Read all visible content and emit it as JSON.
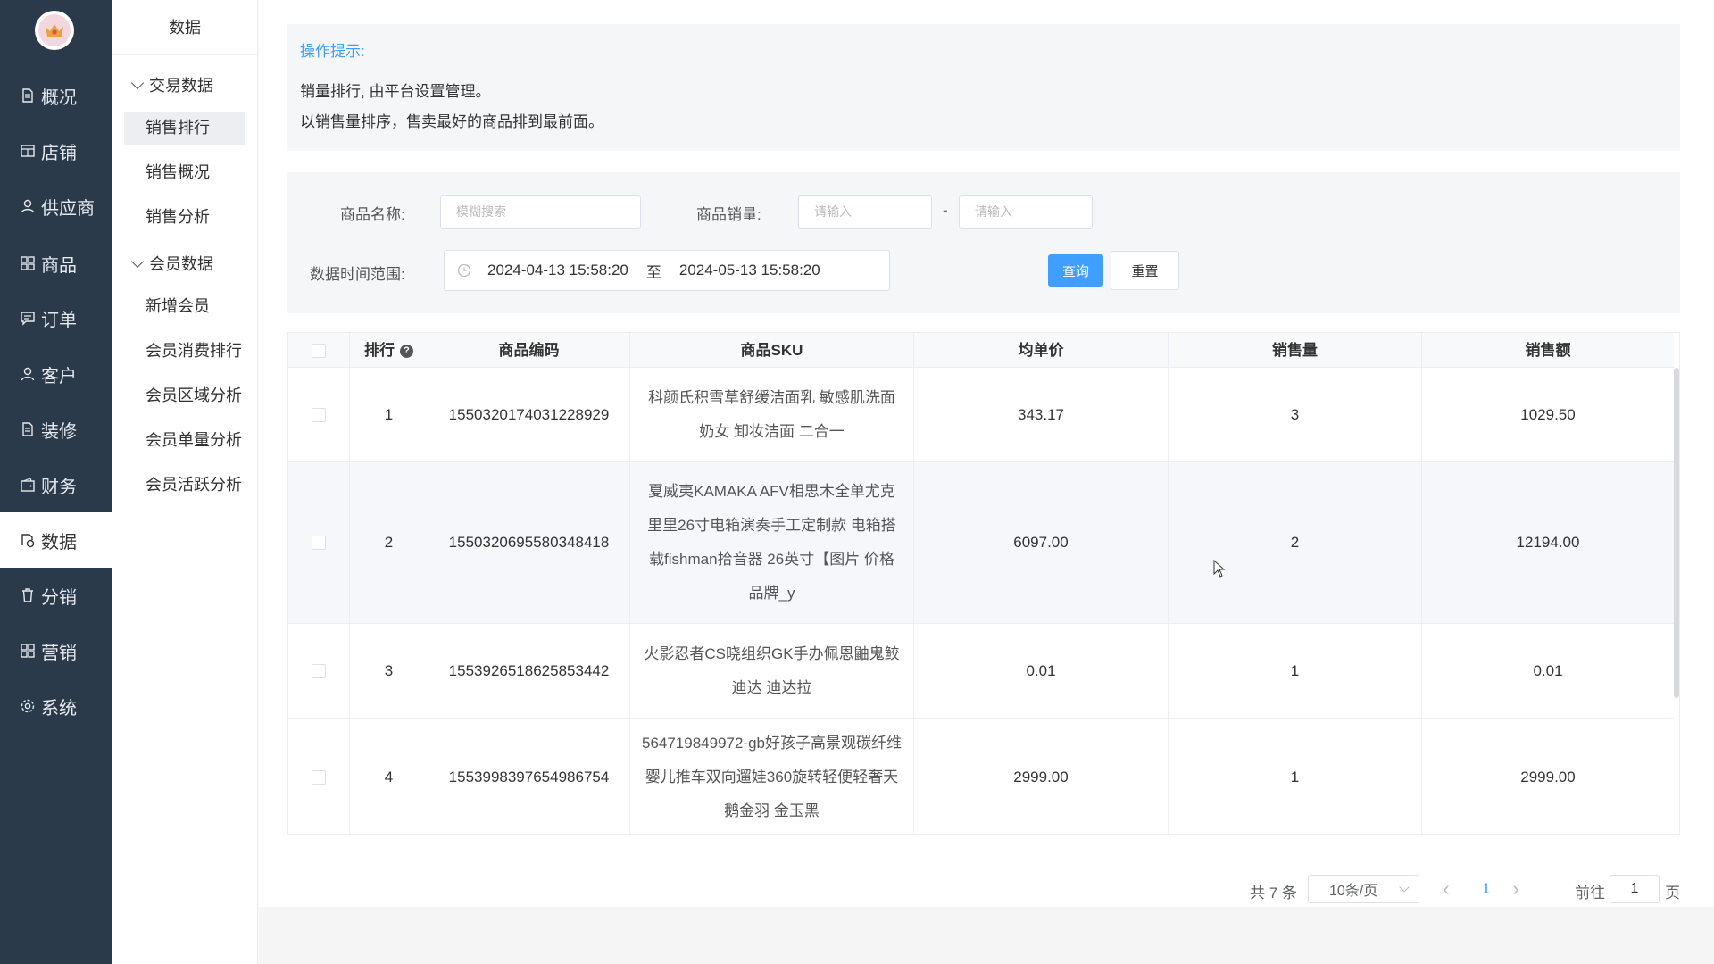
{
  "nav": {
    "items": [
      {
        "label": "概况",
        "icon": "document-icon"
      },
      {
        "label": "店铺",
        "icon": "shop-icon"
      },
      {
        "label": "供应商",
        "icon": "user-icon"
      },
      {
        "label": "商品",
        "icon": "grid-icon"
      },
      {
        "label": "订单",
        "icon": "message-icon"
      },
      {
        "label": "客户",
        "icon": "user-icon"
      },
      {
        "label": "装修",
        "icon": "document-icon"
      },
      {
        "label": "财务",
        "icon": "wallet-icon"
      },
      {
        "label": "数据",
        "icon": "data-icon"
      },
      {
        "label": "分销",
        "icon": "trash-icon"
      },
      {
        "label": "营销",
        "icon": "grid-icon"
      },
      {
        "label": "系统",
        "icon": "gear-icon"
      }
    ],
    "active": "数据"
  },
  "subnav": {
    "title": "数据",
    "groups": [
      {
        "label": "交易数据",
        "items": [
          "销售排行",
          "销售概况",
          "销售分析"
        ]
      },
      {
        "label": "会员数据",
        "items": [
          "新增会员",
          "会员消费排行",
          "会员区域分析",
          "会员单量分析",
          "会员活跃分析"
        ]
      }
    ],
    "active": "销售排行"
  },
  "tips": {
    "title": "操作提示:",
    "lines": [
      "销量排行, 由平台设置管理。",
      "以销售量排序，售卖最好的商品排到最前面。"
    ]
  },
  "filter": {
    "name_label": "商品名称:",
    "name_placeholder": "模糊搜索",
    "sales_label": "商品销量:",
    "sales_min_placeholder": "请输入",
    "sales_max_placeholder": "请输入",
    "sales_dash": "-",
    "date_label": "数据时间范围:",
    "date_start": "2024-04-13 15:58:20",
    "date_sep": "至",
    "date_end": "2024-05-13 15:58:20",
    "query_label": "查询",
    "reset_label": "重置"
  },
  "table": {
    "columns": [
      "排行",
      "商品编码",
      "商品SKU",
      "均单价",
      "销售量",
      "销售额"
    ],
    "rows": [
      {
        "rank": "1",
        "code": "1550320174031228929",
        "sku": "科颜氏积雪草舒缓洁面乳 敏感肌洗面奶女 卸妆洁面 二合一",
        "price": "343.17",
        "qty": "3",
        "amount": "1029.50"
      },
      {
        "rank": "2",
        "code": "1550320695580348418",
        "sku": "夏威夷KAMAKA AFV相思木全单尤克里里26寸电箱演奏手工定制款 电箱搭载fishman拾音器 26英寸【图片 价格 品牌_y",
        "price": "6097.00",
        "qty": "2",
        "amount": "12194.00"
      },
      {
        "rank": "3",
        "code": "1553926518625853442",
        "sku": "火影忍者CS晓组织GK手办佩恩鼬鬼鲛迪达 迪达拉",
        "price": "0.01",
        "qty": "1",
        "amount": "0.01"
      },
      {
        "rank": "4",
        "code": "1553998397654986754",
        "sku": "564719849972-gb好孩子高景观碳纤维婴儿推车双向遛娃360旋转轻便轻奢天鹅金羽 金玉黑",
        "price": "2999.00",
        "qty": "1",
        "amount": "2999.00"
      }
    ]
  },
  "pager": {
    "total": "共 7 条",
    "page_size": "10条/页",
    "current": "1",
    "goto_prefix": "前往",
    "goto_value": "1",
    "goto_suffix": "页"
  },
  "colors": {
    "nav_bg": "#2b3a4a",
    "accent": "#409eff"
  }
}
